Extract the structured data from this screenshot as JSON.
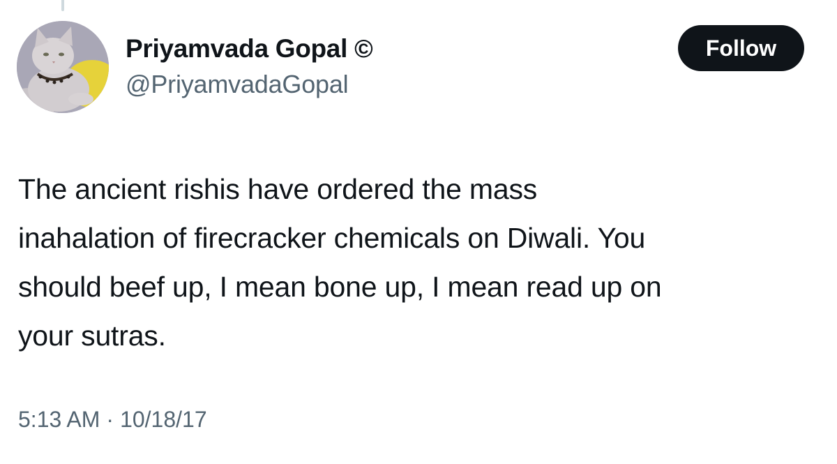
{
  "author": {
    "display_name": "Priyamvada Gopal",
    "name_badge": "©",
    "handle": "@PriyamvadaGopal",
    "avatar_icon": "cat-avatar"
  },
  "follow_button": {
    "label": "Follow"
  },
  "tweet": {
    "lines": [
      "The ancient rishis have ordered the mass",
      "inahalation of firecracker chemicals on Diwali. You",
      "should beef up, I mean bone up, I mean read up on",
      "your sutras."
    ],
    "time": "5:13 AM",
    "separator": "·",
    "date": "10/18/17"
  },
  "colors": {
    "text_primary": "#0f1419",
    "text_secondary": "#536471",
    "button_bg": "#0f1419",
    "button_text": "#ffffff"
  }
}
